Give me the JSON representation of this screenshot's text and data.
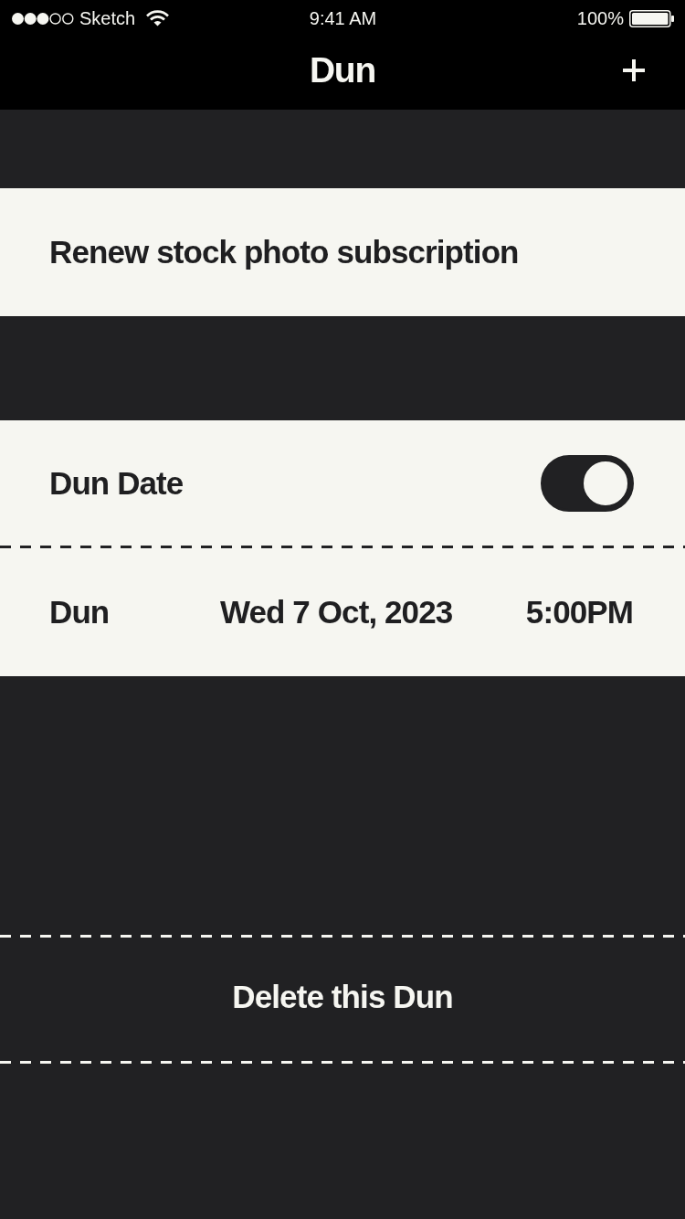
{
  "status_bar": {
    "carrier": "Sketch",
    "time": "9:41 AM",
    "battery": "100%"
  },
  "nav_bar": {
    "title": "Dun"
  },
  "task": {
    "title": "Renew stock photo subscription"
  },
  "settings": {
    "rows": [
      {
        "kind": "toggle",
        "label": "Dun Date",
        "on": true
      },
      {
        "kind": "datetime",
        "label": "Dun",
        "date": "Wed 7 Oct, 2023",
        "time": "5:00PM"
      }
    ]
  },
  "delete_button": {
    "label": "Delete this Dun"
  }
}
